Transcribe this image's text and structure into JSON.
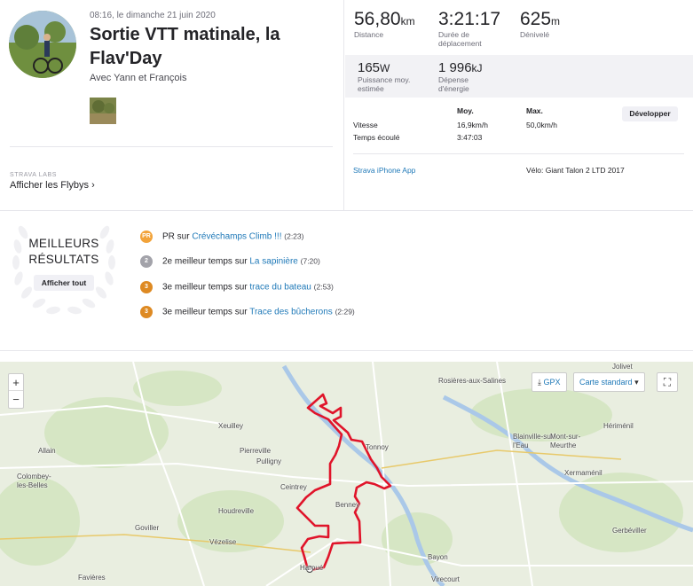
{
  "activity": {
    "datetime": "08:16, le dimanche 21 juin 2020",
    "title": "Sortie VTT matinale, la Flav'Day",
    "with": "Avec Yann et François"
  },
  "labs": {
    "caption": "STRAVA LABS",
    "flyby_label": "Afficher les Flybys ›"
  },
  "stats": {
    "distance": {
      "value": "56,80",
      "unit": "km",
      "label": "Distance"
    },
    "moving_time": {
      "value": "3:21:17",
      "label": "Durée de déplacement"
    },
    "elevation": {
      "value": "625",
      "unit": "m",
      "label": "Dénivelé"
    },
    "power": {
      "value": "165",
      "unit": "W",
      "label": "Puissance moy. estimée"
    },
    "energy": {
      "value": "1 996",
      "unit": "kJ",
      "label": "Dépense d'énergie"
    }
  },
  "table": {
    "col_avg": "Moy.",
    "col_max": "Max.",
    "rows": [
      {
        "label": "Vitesse",
        "avg": "16,9km/h",
        "max": "50,0km/h"
      },
      {
        "label": "Temps écoulé",
        "avg": "3:47:03",
        "max": ""
      }
    ],
    "expand_label": "Développer"
  },
  "device": "Strava iPhone App",
  "bike": "Vélo: Giant Talon 2 LTD 2017",
  "achievements": {
    "title_line1": "MEILLEURS",
    "title_line2": "RÉSULTATS",
    "show_all": "Afficher tout",
    "items": [
      {
        "medal": "PR",
        "medal_color": "#f2a33a",
        "prefix": "PR sur ",
        "segment": "Crévéchamps Climb !!!",
        "time": "(2:23)"
      },
      {
        "medal": "2",
        "medal_color": "#a3a3aa",
        "prefix": "2e meilleur temps sur ",
        "segment": "La sapinière",
        "time": "(7:20)"
      },
      {
        "medal": "3",
        "medal_color": "#de8a23",
        "prefix": "3e meilleur temps sur ",
        "segment": "trace du bateau",
        "time": "(2:53)"
      },
      {
        "medal": "3",
        "medal_color": "#de8a23",
        "prefix": "3e meilleur temps sur ",
        "segment": "Trace des bûcherons",
        "time": "(2:29)"
      }
    ]
  },
  "map": {
    "zoom_in": "+",
    "zoom_out": "−",
    "gpx_label": "GPX",
    "map_type": "Carte standard",
    "route_color": "#e0142a",
    "towns": [
      "Jolivet",
      "Rosières-aux-Salines",
      "Xeuilley",
      "Allain",
      "Colombey-les-Belles",
      "Pierreville",
      "Pulligny",
      "Ceintrey",
      "Tonnoy",
      "Blainville-sur-l'Eau",
      "Mont-sur-Meurthe",
      "Hériménil",
      "Xermaménil",
      "Houdreville",
      "Benney",
      "Goviller",
      "Vézelise",
      "Haroué",
      "Bayon",
      "Gerbéviller",
      "Favières",
      "Virecourt"
    ]
  }
}
